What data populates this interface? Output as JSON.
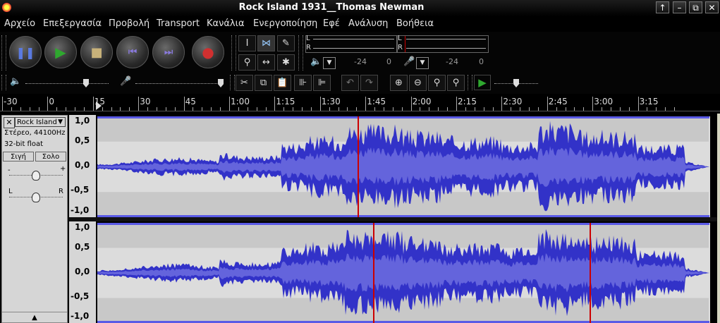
{
  "window": {
    "title": "Rock Island 1931__Thomas Newman",
    "controls": [
      "↑",
      "–",
      "⧉",
      "✕"
    ]
  },
  "menu": [
    {
      "label": "Αρχείο",
      "key": "a"
    },
    {
      "label": "Επεξεργασία",
      "key": "e"
    },
    {
      "label": "Προβολή",
      "key": "p"
    },
    {
      "label": "Transport",
      "key": "t"
    },
    {
      "label": "Κανάλια",
      "key": "k"
    },
    {
      "label": "Ενεργοποίηση",
      "key": "g"
    },
    {
      "label": "Εφέ",
      "key": "f"
    },
    {
      "label": "Ανάλυση",
      "key": "n"
    },
    {
      "label": "Βοήθεια",
      "key": "v"
    }
  ],
  "transport": {
    "buttons": [
      "pause",
      "play",
      "stop",
      "skip-start",
      "skip-end",
      "record"
    ]
  },
  "meter": {
    "l": "L",
    "r": "R",
    "db_left": "-24",
    "zero_left": "0",
    "db_right": "-24",
    "zero_right": "0"
  },
  "ruler": {
    "labels": [
      "-30",
      "0",
      "15",
      "30",
      "45",
      "1:00",
      "1:15",
      "1:30",
      "1:45",
      "2:00",
      "2:15",
      "2:30",
      "2:45",
      "3:00",
      "3:15"
    ]
  },
  "track": {
    "name": "Rock Island",
    "format": "Στέρεο, 44100Hz",
    "bits": "32-bit float",
    "mute_label": "Σιγή",
    "solo_label": "Σολο",
    "pan_l": "L",
    "pan_r": "R",
    "gain_minus": "-",
    "gain_plus": "+",
    "scale": [
      "1,0",
      "0,5",
      "0,0",
      "-0,5",
      "-1,0"
    ]
  },
  "colors": {
    "waveform": "#3232c8",
    "waveform_rms": "#6464dc",
    "background": "#c8c8c8",
    "clip_marker": "#cc0000"
  }
}
